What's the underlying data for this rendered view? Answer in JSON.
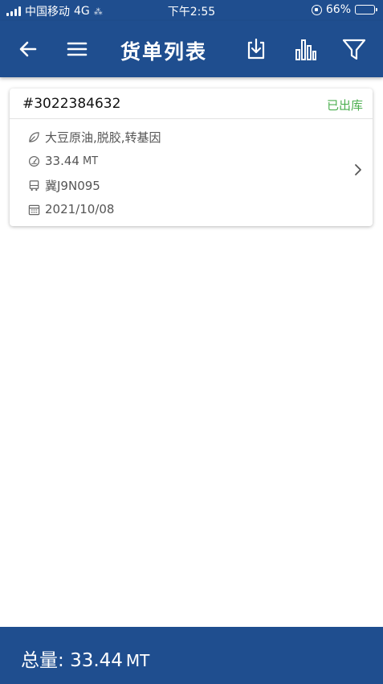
{
  "status_bar": {
    "carrier": "中国移动",
    "network": "4G",
    "time": "下午2:55",
    "battery": "66%",
    "battery_level": 0.66
  },
  "nav": {
    "title": "货单列表",
    "icons": [
      "back-arrow-icon",
      "menu-icon",
      "download-icon",
      "bar-chart-icon",
      "filter-icon"
    ]
  },
  "orders": [
    {
      "order_no": "#3022384632",
      "status": "已出库",
      "product": "大豆原油,脱胶,转基因",
      "quantity": "33.44",
      "quantity_unit": "MT",
      "vehicle": "冀J9N095",
      "date": "2021/10/08"
    }
  ],
  "footer": {
    "total_label": "总量:",
    "total_value": "33.44",
    "total_unit": "MT"
  },
  "colors": {
    "primary": "#1f4e8f",
    "status_green": "#4caf50"
  }
}
